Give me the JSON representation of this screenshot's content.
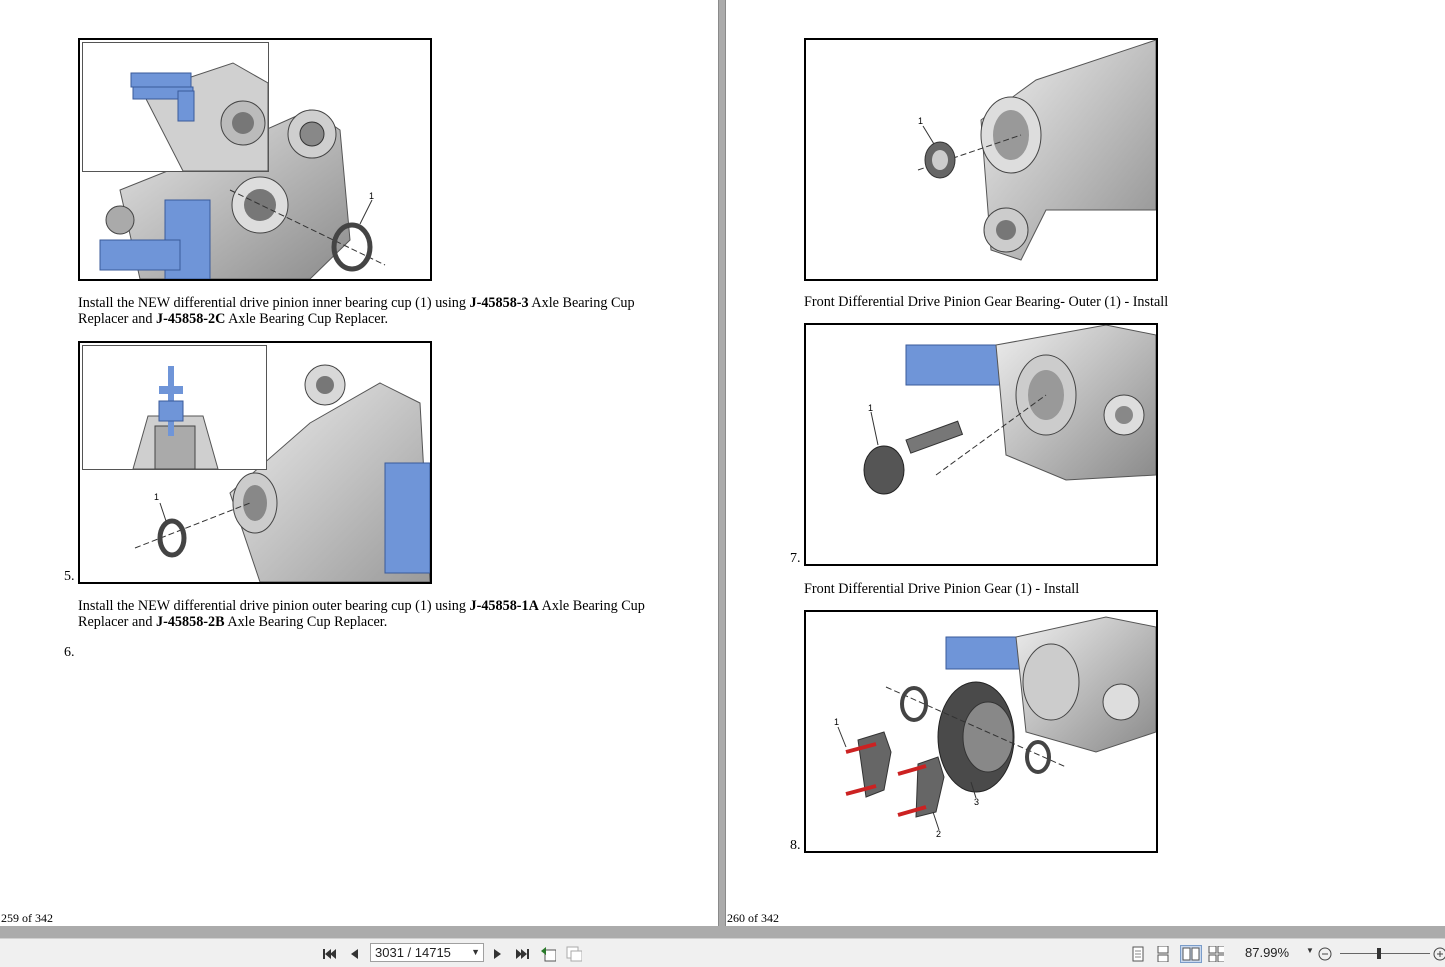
{
  "left_page": {
    "steps": [
      {
        "number": "5.",
        "text_parts": [
          {
            "t": "Install the NEW differential drive pinion inner bearing cup (1) using ",
            "b": false
          },
          {
            "t": "J-45858-3",
            "b": true
          },
          {
            "t": " Axle Bearing Cup Replacer and ",
            "b": false
          },
          {
            "t": "J-45858-2C",
            "b": true
          },
          {
            "t": " Axle Bearing Cup Replacer.",
            "b": false
          }
        ]
      },
      {
        "number": "6.",
        "text_parts": [
          {
            "t": "Install the NEW differential drive pinion outer bearing cup (1) using ",
            "b": false
          },
          {
            "t": "J-45858-1A",
            "b": true
          },
          {
            "t": " Axle Bearing Cup Replacer and ",
            "b": false
          },
          {
            "t": "J-45858-2B",
            "b": true
          },
          {
            "t": " Axle Bearing Cup Replacer.",
            "b": false
          }
        ]
      }
    ],
    "fig_callouts": [
      "1",
      "1"
    ],
    "page_label": "259 of 342"
  },
  "right_page": {
    "captions": [
      "Front Differential Drive Pinion Gear Bearing- Outer (1) - Install",
      "Front Differential Drive Pinion Gear (1) - Install"
    ],
    "step_numbers": [
      "7.",
      "8."
    ],
    "fig_callouts": {
      "fig1": [
        "1"
      ],
      "fig2": [
        "1"
      ],
      "fig3": [
        "1",
        "2",
        "3"
      ]
    },
    "page_label": "260 of 342"
  },
  "toolbar": {
    "page_indicator": "3031 / 14715",
    "zoom": "87.99%",
    "icons": [
      "first-page-icon",
      "previous-page-icon",
      "next-page-icon",
      "last-page-icon",
      "previous-view-icon",
      "next-view-icon",
      "single-page-icon",
      "continuous-icon",
      "facing-icon",
      "continuous-facing-icon",
      "zoom-out-icon",
      "zoom-in-icon"
    ]
  },
  "colors": {
    "tool_blue": "#6f95d8",
    "bolt_red": "#cc2222",
    "housing_gray": "#b8b8b8"
  }
}
